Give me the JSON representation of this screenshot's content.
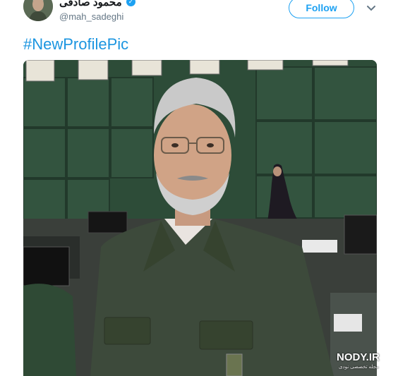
{
  "tweet": {
    "display_name": "محمود صادقی",
    "handle": "@mah_sadeghi",
    "verified_glyph": "✓",
    "follow_label": "Follow",
    "hashtag": "#NewProfilePic"
  },
  "icons": {
    "verified": "verified-badge-icon",
    "more": "chevron-down-icon"
  },
  "watermark": {
    "brand": "NODY.IR",
    "tagline": "مجله تخصصی نودی"
  },
  "colors": {
    "accent": "#1da1f2",
    "hashtag": "#1b95e0",
    "handle": "#657786",
    "name": "#14171a"
  }
}
